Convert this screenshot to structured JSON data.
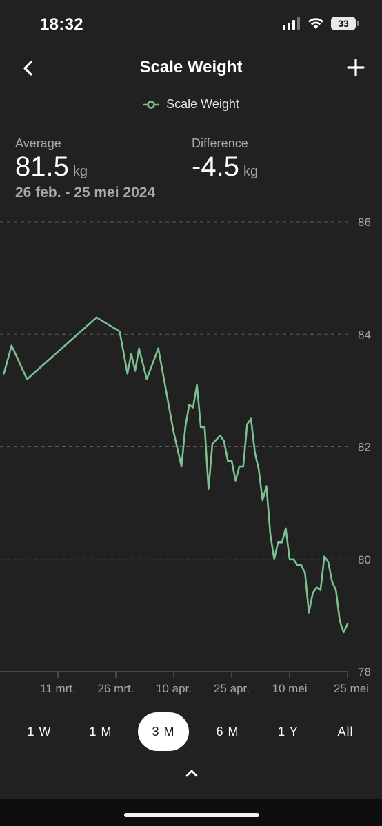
{
  "status": {
    "time": "18:32",
    "battery": "33",
    "icons": [
      "signal-icon",
      "wifi-icon",
      "battery-icon"
    ]
  },
  "nav": {
    "title": "Scale Weight",
    "back_icon": "chevron-left-icon",
    "add_icon": "plus-icon"
  },
  "legend": {
    "label": "Scale Weight",
    "color": "#7cc08f"
  },
  "stats": {
    "average_label": "Average",
    "average_value": "81.5",
    "average_unit": "kg",
    "difference_label": "Difference",
    "difference_value": "-4.5",
    "difference_unit": "kg",
    "date_range": "26 feb. - 25 mei 2024"
  },
  "chart_data": {
    "type": "line",
    "series": [
      {
        "name": "Scale Weight",
        "color": "#7cc08f",
        "points": [
          [
            "2024-02-26",
            83.3
          ],
          [
            "2024-02-28",
            83.8
          ],
          [
            "2024-03-03",
            83.2
          ],
          [
            "2024-03-21",
            84.3
          ],
          [
            "2024-03-27",
            84.05
          ],
          [
            "2024-03-29",
            83.3
          ],
          [
            "2024-03-30",
            83.65
          ],
          [
            "2024-03-31",
            83.35
          ],
          [
            "2024-04-01",
            83.75
          ],
          [
            "2024-04-03",
            83.2
          ],
          [
            "2024-04-06",
            83.75
          ],
          [
            "2024-04-10",
            82.25
          ],
          [
            "2024-04-12",
            81.65
          ],
          [
            "2024-04-13",
            82.35
          ],
          [
            "2024-04-14",
            82.75
          ],
          [
            "2024-04-15",
            82.7
          ],
          [
            "2024-04-16",
            83.1
          ],
          [
            "2024-04-17",
            82.35
          ],
          [
            "2024-04-18",
            82.35
          ],
          [
            "2024-04-19",
            81.25
          ],
          [
            "2024-04-20",
            82.05
          ],
          [
            "2024-04-22",
            82.2
          ],
          [
            "2024-04-23",
            82.1
          ],
          [
            "2024-04-24",
            81.75
          ],
          [
            "2024-04-25",
            81.75
          ],
          [
            "2024-04-26",
            81.4
          ],
          [
            "2024-04-27",
            81.65
          ],
          [
            "2024-04-28",
            81.65
          ],
          [
            "2024-04-29",
            82.4
          ],
          [
            "2024-04-30",
            82.5
          ],
          [
            "2024-05-01",
            81.9
          ],
          [
            "2024-05-02",
            81.6
          ],
          [
            "2024-05-03",
            81.05
          ],
          [
            "2024-05-04",
            81.3
          ],
          [
            "2024-05-05",
            80.45
          ],
          [
            "2024-05-06",
            80.0
          ],
          [
            "2024-05-07",
            80.3
          ],
          [
            "2024-05-08",
            80.3
          ],
          [
            "2024-05-09",
            80.55
          ],
          [
            "2024-05-10",
            80.0
          ],
          [
            "2024-05-11",
            80.0
          ],
          [
            "2024-05-12",
            79.9
          ],
          [
            "2024-05-13",
            79.9
          ],
          [
            "2024-05-14",
            79.75
          ],
          [
            "2024-05-15",
            79.05
          ],
          [
            "2024-05-16",
            79.4
          ],
          [
            "2024-05-17",
            79.5
          ],
          [
            "2024-05-18",
            79.45
          ],
          [
            "2024-05-19",
            80.05
          ],
          [
            "2024-05-20",
            79.95
          ],
          [
            "2024-05-21",
            79.6
          ],
          [
            "2024-05-22",
            79.45
          ],
          [
            "2024-05-23",
            78.9
          ],
          [
            "2024-05-24",
            78.7
          ],
          [
            "2024-05-25",
            78.85
          ]
        ]
      }
    ],
    "x_range": [
      "2024-02-25",
      "2024-05-25"
    ],
    "xticks": [
      {
        "date": "2024-03-11",
        "label": "11 mrt."
      },
      {
        "date": "2024-03-26",
        "label": "26 mrt."
      },
      {
        "date": "2024-04-10",
        "label": "10 apr."
      },
      {
        "date": "2024-04-25",
        "label": "25 apr."
      },
      {
        "date": "2024-05-10",
        "label": "10 mei"
      },
      {
        "date": "2024-05-25",
        "label": "25 mei"
      }
    ],
    "yticks": [
      86,
      84,
      82,
      80,
      78
    ],
    "ylim": [
      78,
      86
    ],
    "grid": true,
    "y_axis_side": "right"
  },
  "ranges": {
    "items": [
      {
        "label": "1 W"
      },
      {
        "label": "1 M"
      },
      {
        "label": "3 M"
      },
      {
        "label": "6 M"
      },
      {
        "label": "1 Y"
      },
      {
        "label": "All"
      }
    ],
    "active": "3 M"
  }
}
